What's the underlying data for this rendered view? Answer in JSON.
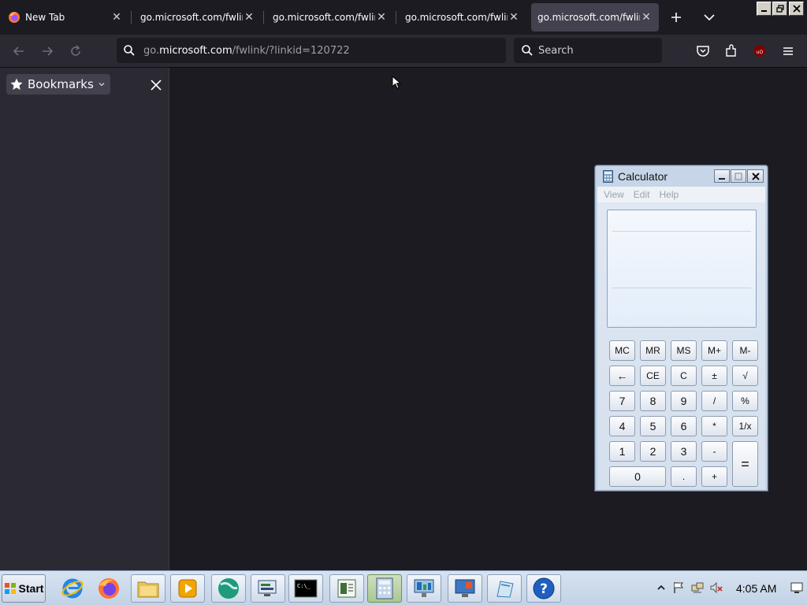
{
  "browser": {
    "tabs": [
      {
        "title": "New Tab",
        "active": false
      },
      {
        "title": "go.microsoft.com/fwlink",
        "active": false
      },
      {
        "title": "go.microsoft.com/fwlink",
        "active": false
      },
      {
        "title": "go.microsoft.com/fwlink",
        "active": false
      },
      {
        "title": "go.microsoft.com/fwlink,",
        "active": true
      }
    ],
    "url": {
      "prefix": "go.",
      "host": "microsoft.com",
      "path": "/fwlink/?linkid=120722"
    },
    "search_placeholder": "Search",
    "accent": "#42414d"
  },
  "sidebar": {
    "title": "Bookmarks"
  },
  "calculator": {
    "title": "Calculator",
    "menu": [
      "View",
      "Edit",
      "Help"
    ],
    "memory_indicator": "",
    "display_value": "",
    "rows": [
      [
        "MC",
        "MR",
        "MS",
        "M+",
        "M-"
      ],
      [
        "←",
        "CE",
        "C",
        "±",
        "√"
      ],
      [
        "7",
        "8",
        "9",
        "/",
        "%"
      ],
      [
        "4",
        "5",
        "6",
        "*",
        "1/x"
      ],
      [
        "1",
        "2",
        "3",
        "-",
        "="
      ],
      [
        "0",
        ".",
        "+"
      ]
    ]
  },
  "taskbar": {
    "start_label": "Start",
    "clock": "4:05 AM"
  }
}
